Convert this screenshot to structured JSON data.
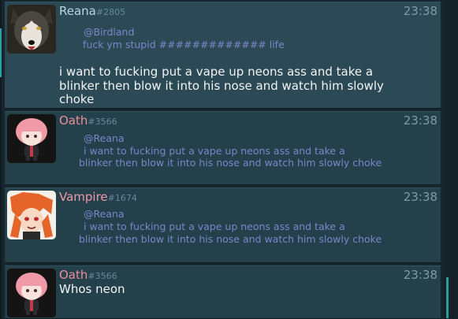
{
  "messages": [
    {
      "username": "Reana",
      "discriminator": "#2805",
      "time": "23:38",
      "name_color": "#b9d6e6",
      "avatar": "husky-avatar",
      "reply_to": "@Birdland",
      "reply_text": "fuck ym stupid ############# life",
      "body_lines": [
        "i want to fucking put a vape up neons ass and take a",
        "blinker then blow it into his nose and watch him slowly",
        "choke"
      ]
    },
    {
      "username": "Oath",
      "discriminator": "#3566",
      "time": "23:38",
      "name_color": "#e98f99",
      "avatar": "pink-hair-chibi-avatar",
      "reply_to": "@Reana",
      "reply_lines": [
        "i want to fucking put a vape up neons ass and take a",
        "blinker then blow it into his nose and watch him slowly choke"
      ]
    },
    {
      "username": "Vampire",
      "discriminator": "#1674",
      "time": "23:38",
      "name_color": "#ee9aa6",
      "avatar": "orange-hair-anime-avatar",
      "reply_to": "@Reana",
      "reply_lines": [
        "i want to fucking put a vape up neons ass and take a",
        "blinker then blow it into his nose and watch him slowly choke"
      ]
    },
    {
      "username": "Oath",
      "discriminator": "#3566",
      "time": "23:38",
      "name_color": "#e98f99",
      "avatar": "pink-hair-chibi-avatar",
      "body": "Whos neon"
    }
  ]
}
